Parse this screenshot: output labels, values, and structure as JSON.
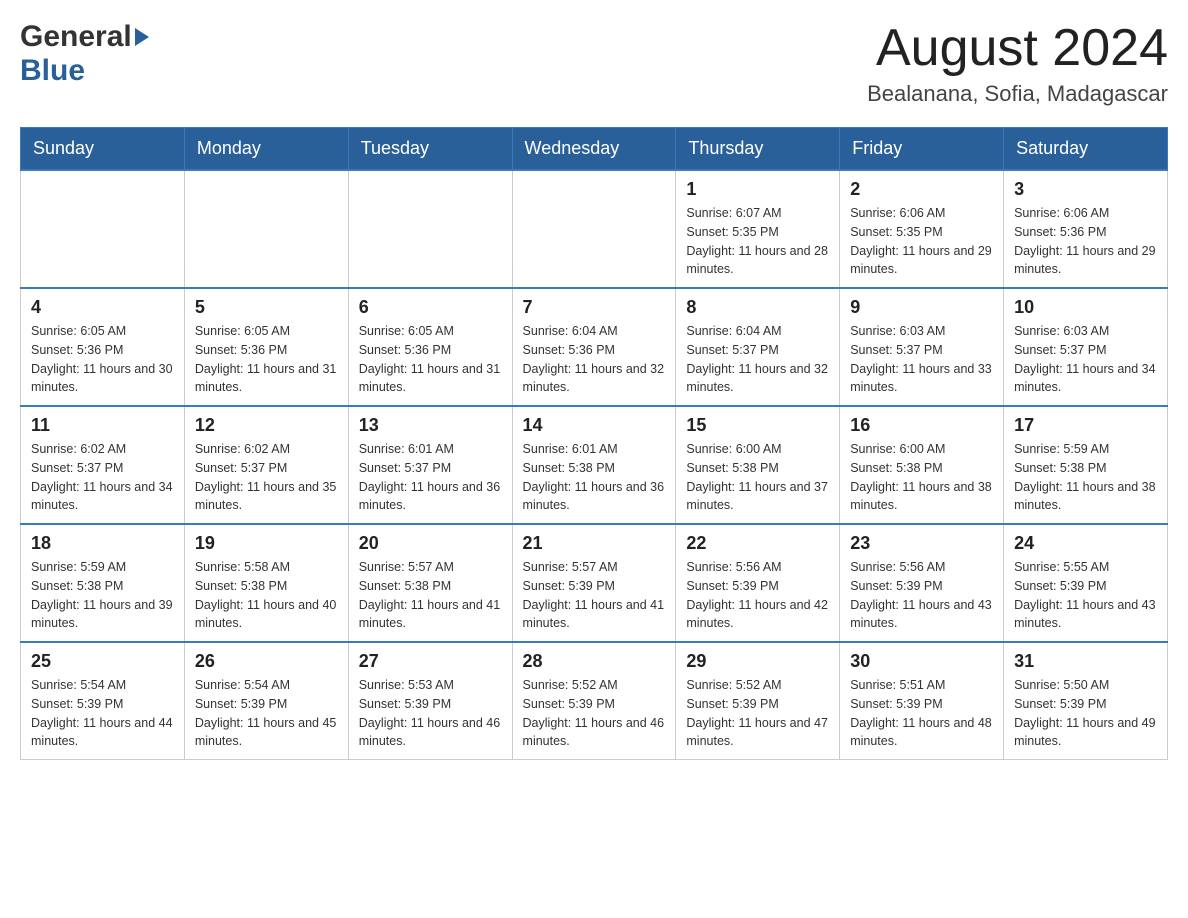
{
  "header": {
    "logo_general": "General",
    "logo_blue": "Blue",
    "month_title": "August 2024",
    "location": "Bealanana, Sofia, Madagascar"
  },
  "weekdays": [
    "Sunday",
    "Monday",
    "Tuesday",
    "Wednesday",
    "Thursday",
    "Friday",
    "Saturday"
  ],
  "weeks": [
    [
      {
        "day": "",
        "info": ""
      },
      {
        "day": "",
        "info": ""
      },
      {
        "day": "",
        "info": ""
      },
      {
        "day": "",
        "info": ""
      },
      {
        "day": "1",
        "info": "Sunrise: 6:07 AM\nSunset: 5:35 PM\nDaylight: 11 hours and 28 minutes."
      },
      {
        "day": "2",
        "info": "Sunrise: 6:06 AM\nSunset: 5:35 PM\nDaylight: 11 hours and 29 minutes."
      },
      {
        "day": "3",
        "info": "Sunrise: 6:06 AM\nSunset: 5:36 PM\nDaylight: 11 hours and 29 minutes."
      }
    ],
    [
      {
        "day": "4",
        "info": "Sunrise: 6:05 AM\nSunset: 5:36 PM\nDaylight: 11 hours and 30 minutes."
      },
      {
        "day": "5",
        "info": "Sunrise: 6:05 AM\nSunset: 5:36 PM\nDaylight: 11 hours and 31 minutes."
      },
      {
        "day": "6",
        "info": "Sunrise: 6:05 AM\nSunset: 5:36 PM\nDaylight: 11 hours and 31 minutes."
      },
      {
        "day": "7",
        "info": "Sunrise: 6:04 AM\nSunset: 5:36 PM\nDaylight: 11 hours and 32 minutes."
      },
      {
        "day": "8",
        "info": "Sunrise: 6:04 AM\nSunset: 5:37 PM\nDaylight: 11 hours and 32 minutes."
      },
      {
        "day": "9",
        "info": "Sunrise: 6:03 AM\nSunset: 5:37 PM\nDaylight: 11 hours and 33 minutes."
      },
      {
        "day": "10",
        "info": "Sunrise: 6:03 AM\nSunset: 5:37 PM\nDaylight: 11 hours and 34 minutes."
      }
    ],
    [
      {
        "day": "11",
        "info": "Sunrise: 6:02 AM\nSunset: 5:37 PM\nDaylight: 11 hours and 34 minutes."
      },
      {
        "day": "12",
        "info": "Sunrise: 6:02 AM\nSunset: 5:37 PM\nDaylight: 11 hours and 35 minutes."
      },
      {
        "day": "13",
        "info": "Sunrise: 6:01 AM\nSunset: 5:37 PM\nDaylight: 11 hours and 36 minutes."
      },
      {
        "day": "14",
        "info": "Sunrise: 6:01 AM\nSunset: 5:38 PM\nDaylight: 11 hours and 36 minutes."
      },
      {
        "day": "15",
        "info": "Sunrise: 6:00 AM\nSunset: 5:38 PM\nDaylight: 11 hours and 37 minutes."
      },
      {
        "day": "16",
        "info": "Sunrise: 6:00 AM\nSunset: 5:38 PM\nDaylight: 11 hours and 38 minutes."
      },
      {
        "day": "17",
        "info": "Sunrise: 5:59 AM\nSunset: 5:38 PM\nDaylight: 11 hours and 38 minutes."
      }
    ],
    [
      {
        "day": "18",
        "info": "Sunrise: 5:59 AM\nSunset: 5:38 PM\nDaylight: 11 hours and 39 minutes."
      },
      {
        "day": "19",
        "info": "Sunrise: 5:58 AM\nSunset: 5:38 PM\nDaylight: 11 hours and 40 minutes."
      },
      {
        "day": "20",
        "info": "Sunrise: 5:57 AM\nSunset: 5:38 PM\nDaylight: 11 hours and 41 minutes."
      },
      {
        "day": "21",
        "info": "Sunrise: 5:57 AM\nSunset: 5:39 PM\nDaylight: 11 hours and 41 minutes."
      },
      {
        "day": "22",
        "info": "Sunrise: 5:56 AM\nSunset: 5:39 PM\nDaylight: 11 hours and 42 minutes."
      },
      {
        "day": "23",
        "info": "Sunrise: 5:56 AM\nSunset: 5:39 PM\nDaylight: 11 hours and 43 minutes."
      },
      {
        "day": "24",
        "info": "Sunrise: 5:55 AM\nSunset: 5:39 PM\nDaylight: 11 hours and 43 minutes."
      }
    ],
    [
      {
        "day": "25",
        "info": "Sunrise: 5:54 AM\nSunset: 5:39 PM\nDaylight: 11 hours and 44 minutes."
      },
      {
        "day": "26",
        "info": "Sunrise: 5:54 AM\nSunset: 5:39 PM\nDaylight: 11 hours and 45 minutes."
      },
      {
        "day": "27",
        "info": "Sunrise: 5:53 AM\nSunset: 5:39 PM\nDaylight: 11 hours and 46 minutes."
      },
      {
        "day": "28",
        "info": "Sunrise: 5:52 AM\nSunset: 5:39 PM\nDaylight: 11 hours and 46 minutes."
      },
      {
        "day": "29",
        "info": "Sunrise: 5:52 AM\nSunset: 5:39 PM\nDaylight: 11 hours and 47 minutes."
      },
      {
        "day": "30",
        "info": "Sunrise: 5:51 AM\nSunset: 5:39 PM\nDaylight: 11 hours and 48 minutes."
      },
      {
        "day": "31",
        "info": "Sunrise: 5:50 AM\nSunset: 5:39 PM\nDaylight: 11 hours and 49 minutes."
      }
    ]
  ]
}
